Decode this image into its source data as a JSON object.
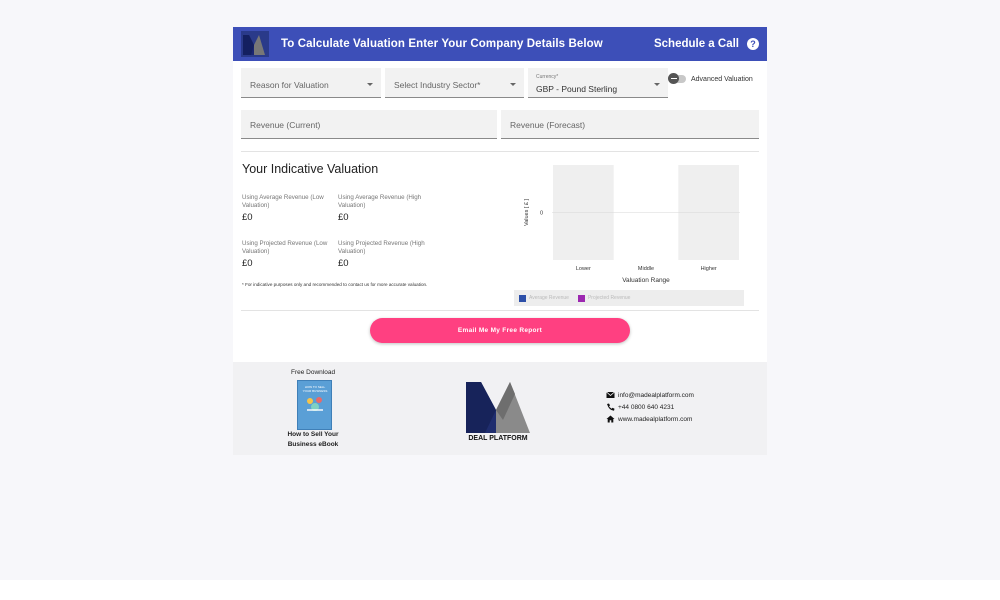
{
  "header": {
    "title": "To Calculate Valuation Enter Your Company Details Below",
    "schedule_label": "Schedule a Call",
    "help_icon": "question-circle-icon",
    "bg_color": "#3d4fb8"
  },
  "form": {
    "reason_placeholder": "Reason for Valuation",
    "industry_placeholder": "Select Industry Sector*",
    "currency_label": "Currency*",
    "currency_value": "GBP - Pound Sterling",
    "advanced_toggle_label": "Advanced Valuation",
    "advanced_toggle_on": false,
    "revenue_current_placeholder": "Revenue (Current)",
    "revenue_forecast_placeholder": "Revenue (Forecast)"
  },
  "valuation": {
    "title": "Your Indicative Valuation",
    "avg_low_label": "Using Average Revenue (Low Valuation)",
    "avg_low_value": "£0",
    "avg_high_label": "Using Average Revenue (High Valuation)",
    "avg_high_value": "£0",
    "proj_low_label": "Using Projected Revenue (Low Valuation)",
    "proj_low_value": "£0",
    "proj_high_label": "Using Projected Revenue (High Valuation)",
    "proj_high_value": "£0",
    "disclaimer": "* For indicative purposes only and recommended to contact us for more accurate valuation."
  },
  "chart_data": {
    "type": "bar",
    "categories": [
      "Lower",
      "Middle",
      "Higher"
    ],
    "series": [
      {
        "name": "Average Revenue",
        "values": [
          0,
          0,
          0
        ],
        "color": "#2c4fa8"
      },
      {
        "name": "Projected Revenue",
        "values": [
          0,
          0,
          0
        ],
        "color": "#9c27b0"
      }
    ],
    "xlabel": "Valuation Range",
    "ylabel": "Values [ £ ]",
    "y_ticks": [
      "0"
    ],
    "band_categories": [
      "Lower",
      "Higher"
    ],
    "legend_position": "bottom"
  },
  "email_button_label": "Email Me My Free Report",
  "email_button_color": "#ff4081",
  "footer": {
    "free_download": "Free Download",
    "ebook_title": "HOW TO SELL YOUR BUSINESS",
    "ebook_caption_line1": "How to Sell Your",
    "ebook_caption_line2": "Business eBook",
    "logo_text": "DEAL PLATFORM",
    "email": "info@madealplatform.com",
    "phone": "+44 0800 640 4231",
    "website": "www.madealplatform.com",
    "email_icon": "envelope-icon",
    "phone_icon": "phone-icon",
    "web_icon": "home-icon"
  }
}
